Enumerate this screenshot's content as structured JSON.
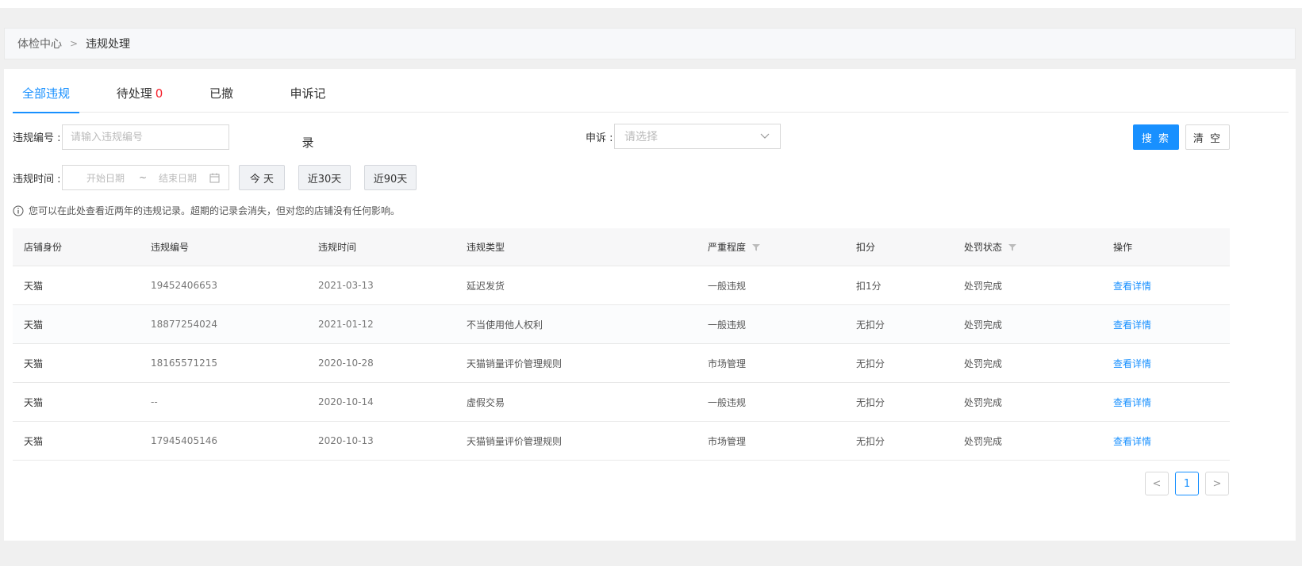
{
  "breadcrumb": {
    "parent": "体检中心",
    "separator": ">",
    "current": "违规处理"
  },
  "tabs": [
    {
      "label": "全部违规",
      "active": true
    },
    {
      "label": "待处理",
      "count": "0"
    },
    {
      "label": "已撤销"
    },
    {
      "label": "申诉记录"
    }
  ],
  "filters": {
    "violation_no_label": "违规编号 :",
    "violation_no_placeholder": "请输入违规编号",
    "appeal_label": "申诉 :",
    "appeal_placeholder": "请选择",
    "time_label": "违规时间 :",
    "start_placeholder": "开始日期",
    "range_sep": "~",
    "end_placeholder": "结束日期",
    "quick_today": "今 天",
    "quick_30": "近30天",
    "quick_90": "近90天",
    "search_label": "搜 索",
    "clear_label": "清 空"
  },
  "notice": "您可以在此处查看近两年的违规记录。超期的记录会消失，但对您的店铺没有任何影响。",
  "table": {
    "headers": [
      "店铺身份",
      "违规编号",
      "违规时间",
      "违规类型",
      "严重程度",
      "扣分",
      "处罚状态",
      "操作"
    ],
    "rows": [
      [
        "天猫",
        "19452406653",
        "2021-03-13",
        "延迟发货",
        "一般违规",
        "扣1分",
        "处罚完成",
        "查看详情"
      ],
      [
        "天猫",
        "18877254024",
        "2021-01-12",
        "不当使用他人权利",
        "一般违规",
        "无扣分",
        "处罚完成",
        "查看详情"
      ],
      [
        "天猫",
        "18165571215",
        "2020-10-28",
        "天猫销量评价管理规则",
        "市场管理",
        "无扣分",
        "处罚完成",
        "查看详情"
      ],
      [
        "天猫",
        "--",
        "2020-10-14",
        "虚假交易",
        "一般违规",
        "无扣分",
        "处罚完成",
        "查看详情"
      ],
      [
        "天猫",
        "17945405146",
        "2020-10-13",
        "天猫销量评价管理规则",
        "市场管理",
        "无扣分",
        "处罚完成",
        "查看详情"
      ]
    ]
  },
  "pagination": {
    "prev": "<",
    "current": "1",
    "next": ">"
  },
  "colors": {
    "accent": "#1890ff",
    "danger": "#f5222d"
  }
}
